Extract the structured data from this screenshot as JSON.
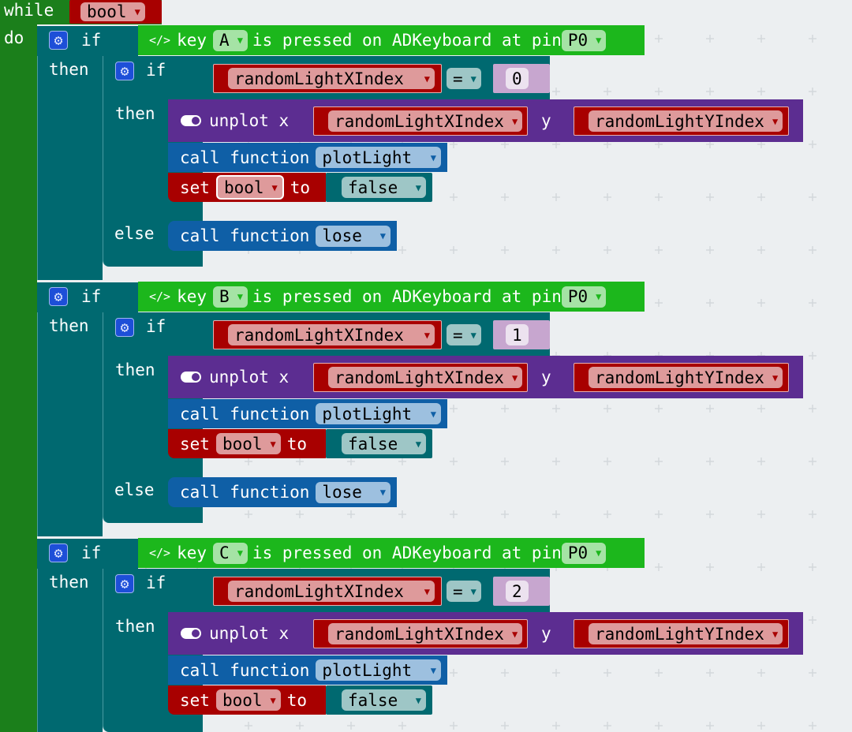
{
  "colors": {
    "loops": "#1b7f1b",
    "logic": "#006970",
    "variables": "#a80000",
    "variables_field": "#de9a9b",
    "keyboard": "#1cb71c",
    "keyboard_field": "#a5e3a5",
    "led": "#5c2d91",
    "functions": "#0f5fa6",
    "functions_field": "#9dc0df",
    "logic_field": "#9ec6c6",
    "math": "#c7a6cf",
    "math_field": "#ece2ef",
    "gear": "#1d4fd8"
  },
  "while_block": {
    "label": "while",
    "var": "bool",
    "do_label": "do"
  },
  "sections": [
    {
      "if_label": "if",
      "key_label": "key",
      "key": "A",
      "pressed_label": "is pressed on ADKeyboard at pin",
      "pin": "P0",
      "then_label": "then",
      "inner": {
        "if_label": "if",
        "var": "randomLightXIndex",
        "op": "=",
        "value": "0",
        "then_label": "then",
        "unplot_label": "unplot x",
        "x_var": "randomLightXIndex",
        "y_label": "y",
        "y_var": "randomLightYIndex",
        "call_label": "call function",
        "call_fn": "plotLight",
        "set_label": "set",
        "set_var": "bool",
        "to_label": "to",
        "set_value": "false",
        "else_label": "else",
        "else_call_label": "call function",
        "else_fn": "lose"
      }
    },
    {
      "if_label": "if",
      "key_label": "key",
      "key": "B",
      "pressed_label": "is pressed on ADKeyboard at pin",
      "pin": "P0",
      "then_label": "then",
      "inner": {
        "if_label": "if",
        "var": "randomLightXIndex",
        "op": "=",
        "value": "1",
        "then_label": "then",
        "unplot_label": "unplot x",
        "x_var": "randomLightXIndex",
        "y_label": "y",
        "y_var": "randomLightYIndex",
        "call_label": "call function",
        "call_fn": "plotLight",
        "set_label": "set",
        "set_var": "bool",
        "to_label": "to",
        "set_value": "false",
        "else_label": "else",
        "else_call_label": "call function",
        "else_fn": "lose"
      }
    },
    {
      "if_label": "if",
      "key_label": "key",
      "key": "C",
      "pressed_label": "is pressed on ADKeyboard at pin",
      "pin": "P0",
      "then_label": "then",
      "inner": {
        "if_label": "if",
        "var": "randomLightXIndex",
        "op": "=",
        "value": "2",
        "then_label": "then",
        "unplot_label": "unplot x",
        "x_var": "randomLightXIndex",
        "y_label": "y",
        "y_var": "randomLightYIndex",
        "call_label": "call function",
        "call_fn": "plotLight",
        "set_label": "set",
        "set_var": "bool",
        "to_label": "to",
        "set_value": "false"
      }
    }
  ]
}
